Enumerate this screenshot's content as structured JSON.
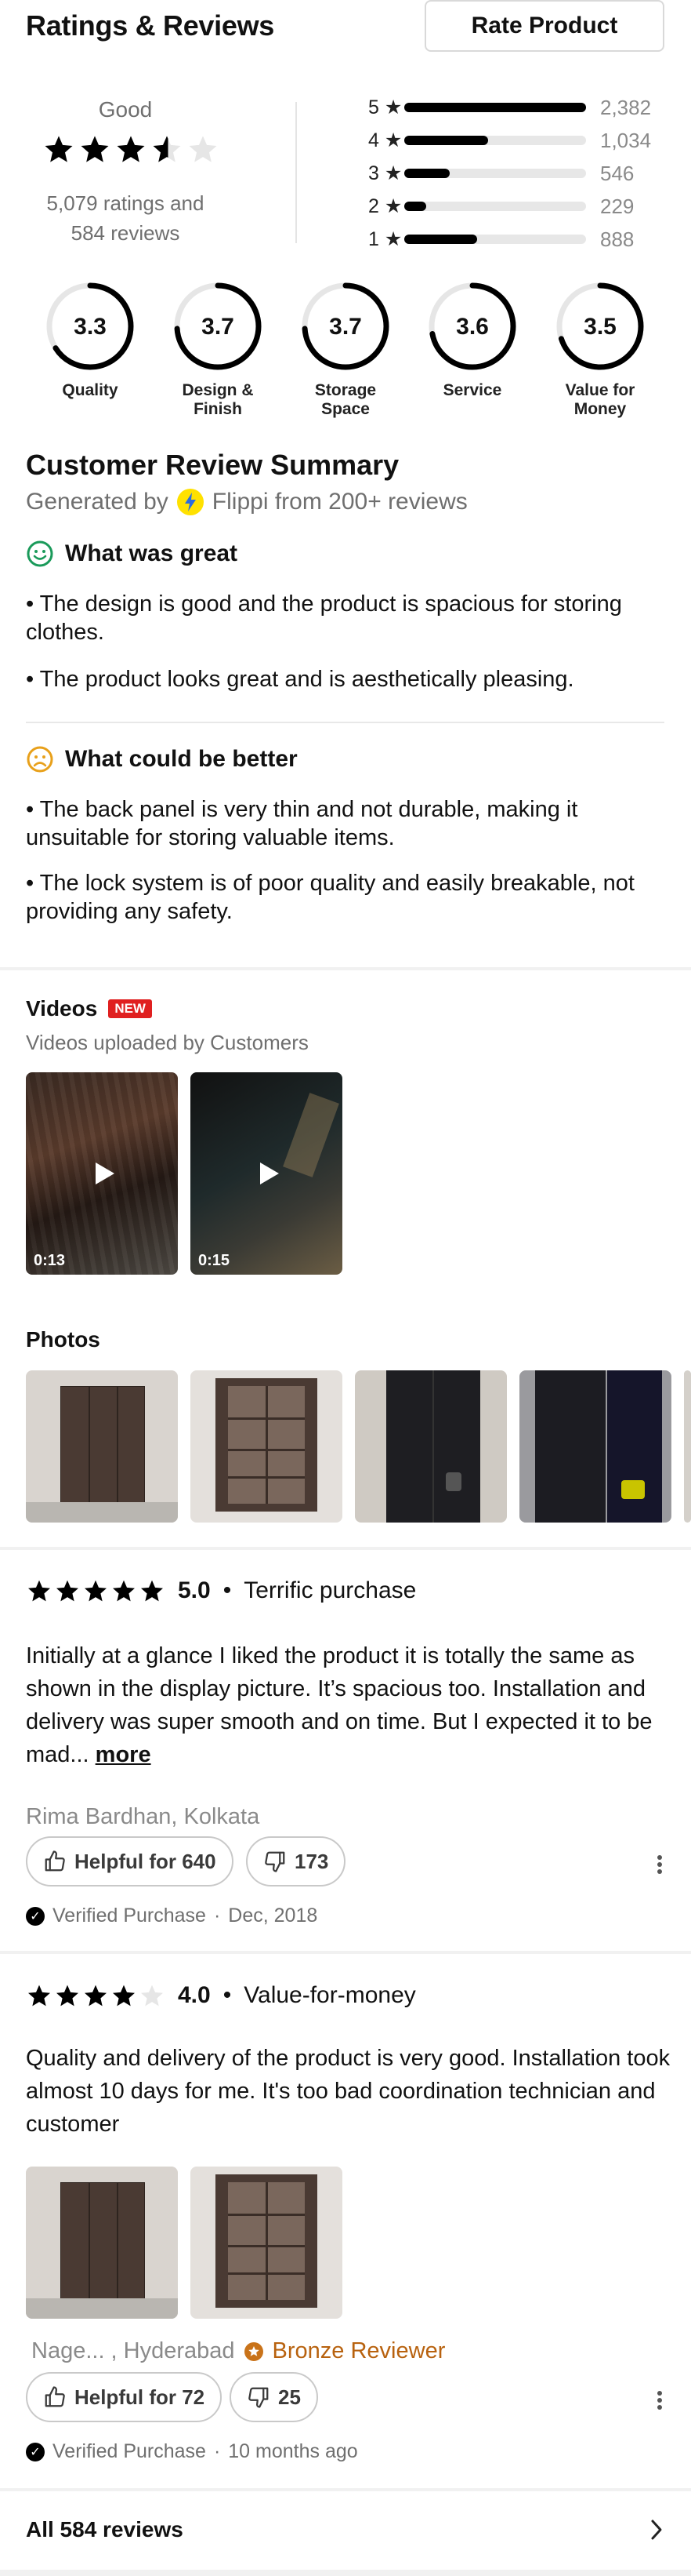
{
  "header": {
    "title": "Ratings & Reviews",
    "rate_button": "Rate Product"
  },
  "overall": {
    "label": "Good",
    "stars": 3.5,
    "ratings_text": "5,079 ratings and",
    "reviews_text": "584 reviews"
  },
  "distribution": [
    {
      "star": "5 ★",
      "count": "2,382",
      "fraction": 1.0
    },
    {
      "star": "4 ★",
      "count": "1,034",
      "fraction": 0.46
    },
    {
      "star": "3 ★",
      "count": "546",
      "fraction": 0.25
    },
    {
      "star": "2 ★",
      "count": "229",
      "fraction": 0.12
    },
    {
      "star": "1 ★",
      "count": "888",
      "fraction": 0.4
    }
  ],
  "aspects": [
    {
      "score": "3.3",
      "label_line1": "Quality",
      "label_line2": "",
      "fraction": 0.66
    },
    {
      "score": "3.7",
      "label_line1": "Design &",
      "label_line2": "Finish",
      "fraction": 0.74
    },
    {
      "score": "3.7",
      "label_line1": "Storage",
      "label_line2": "Space",
      "fraction": 0.74
    },
    {
      "score": "3.6",
      "label_line1": "Service",
      "label_line2": "",
      "fraction": 0.72
    },
    {
      "score": "3.5",
      "label_line1": "Value for",
      "label_line2": "Money",
      "fraction": 0.7
    }
  ],
  "summary": {
    "title": "Customer Review Summary",
    "generated_prefix": "Generated by",
    "generated_suffix": "Flippi from 200+ reviews",
    "great": {
      "heading": "What was great",
      "items": [
        "• The design is good and the product is spacious for storing clothes.",
        "• The product looks great and is aesthetically pleasing."
      ]
    },
    "better": {
      "heading": "What could be better",
      "items": [
        "• The back panel is very thin and not durable, making it unsuitable for storing valuable items.",
        "• The lock system is of poor quality and easily breakable, not providing any safety."
      ]
    }
  },
  "videos": {
    "title": "Videos",
    "badge": "NEW",
    "subtitle": "Videos uploaded by Customers",
    "items": [
      {
        "duration": "0:13"
      },
      {
        "duration": "0:15"
      }
    ]
  },
  "photos": {
    "title": "Photos"
  },
  "reviews": [
    {
      "rating": 5,
      "score": "5.0",
      "title": "Terrific purchase",
      "body": "Initially at a glance I liked the product it is totally the same as shown in the display picture. It’s spacious too. Installation and delivery was super smooth and on time. But I expected it to be mad...",
      "more": "more",
      "author": "Rima Bardhan, Kolkata",
      "helpful": "Helpful for 640",
      "dislikes": "173",
      "verified": "Verified Purchase",
      "date": "Dec, 2018"
    },
    {
      "rating": 4,
      "score": "4.0",
      "title": "Value-for-money",
      "body": "Quality and delivery of the product is very good. Installation took almost 10 days for me. It's too bad coordination technician and customer",
      "author": "Nage... , Hyderabad",
      "badge": "Bronze Reviewer",
      "helpful": "Helpful for 72",
      "dislikes": "25",
      "verified": "Verified Purchase",
      "date": "10 months ago"
    }
  ],
  "footer": {
    "all_reviews": "All 584 reviews"
  },
  "colors": {
    "accent_green": "#1a9a5a",
    "accent_orange": "#e8a01a",
    "badge_red": "#e02020",
    "bronze": "#b8620f"
  },
  "icons": {
    "smile": "smile-icon",
    "frown": "frown-icon",
    "flippi": "flippi-logo-icon",
    "play": "play-icon",
    "thumbs_up": "thumbs-up-icon",
    "thumbs_down": "thumbs-down-icon",
    "verified": "verified-check-icon",
    "more": "kebab-menu-icon",
    "chevron": "chevron-right-icon",
    "bronze_badge": "bronze-badge-icon"
  }
}
